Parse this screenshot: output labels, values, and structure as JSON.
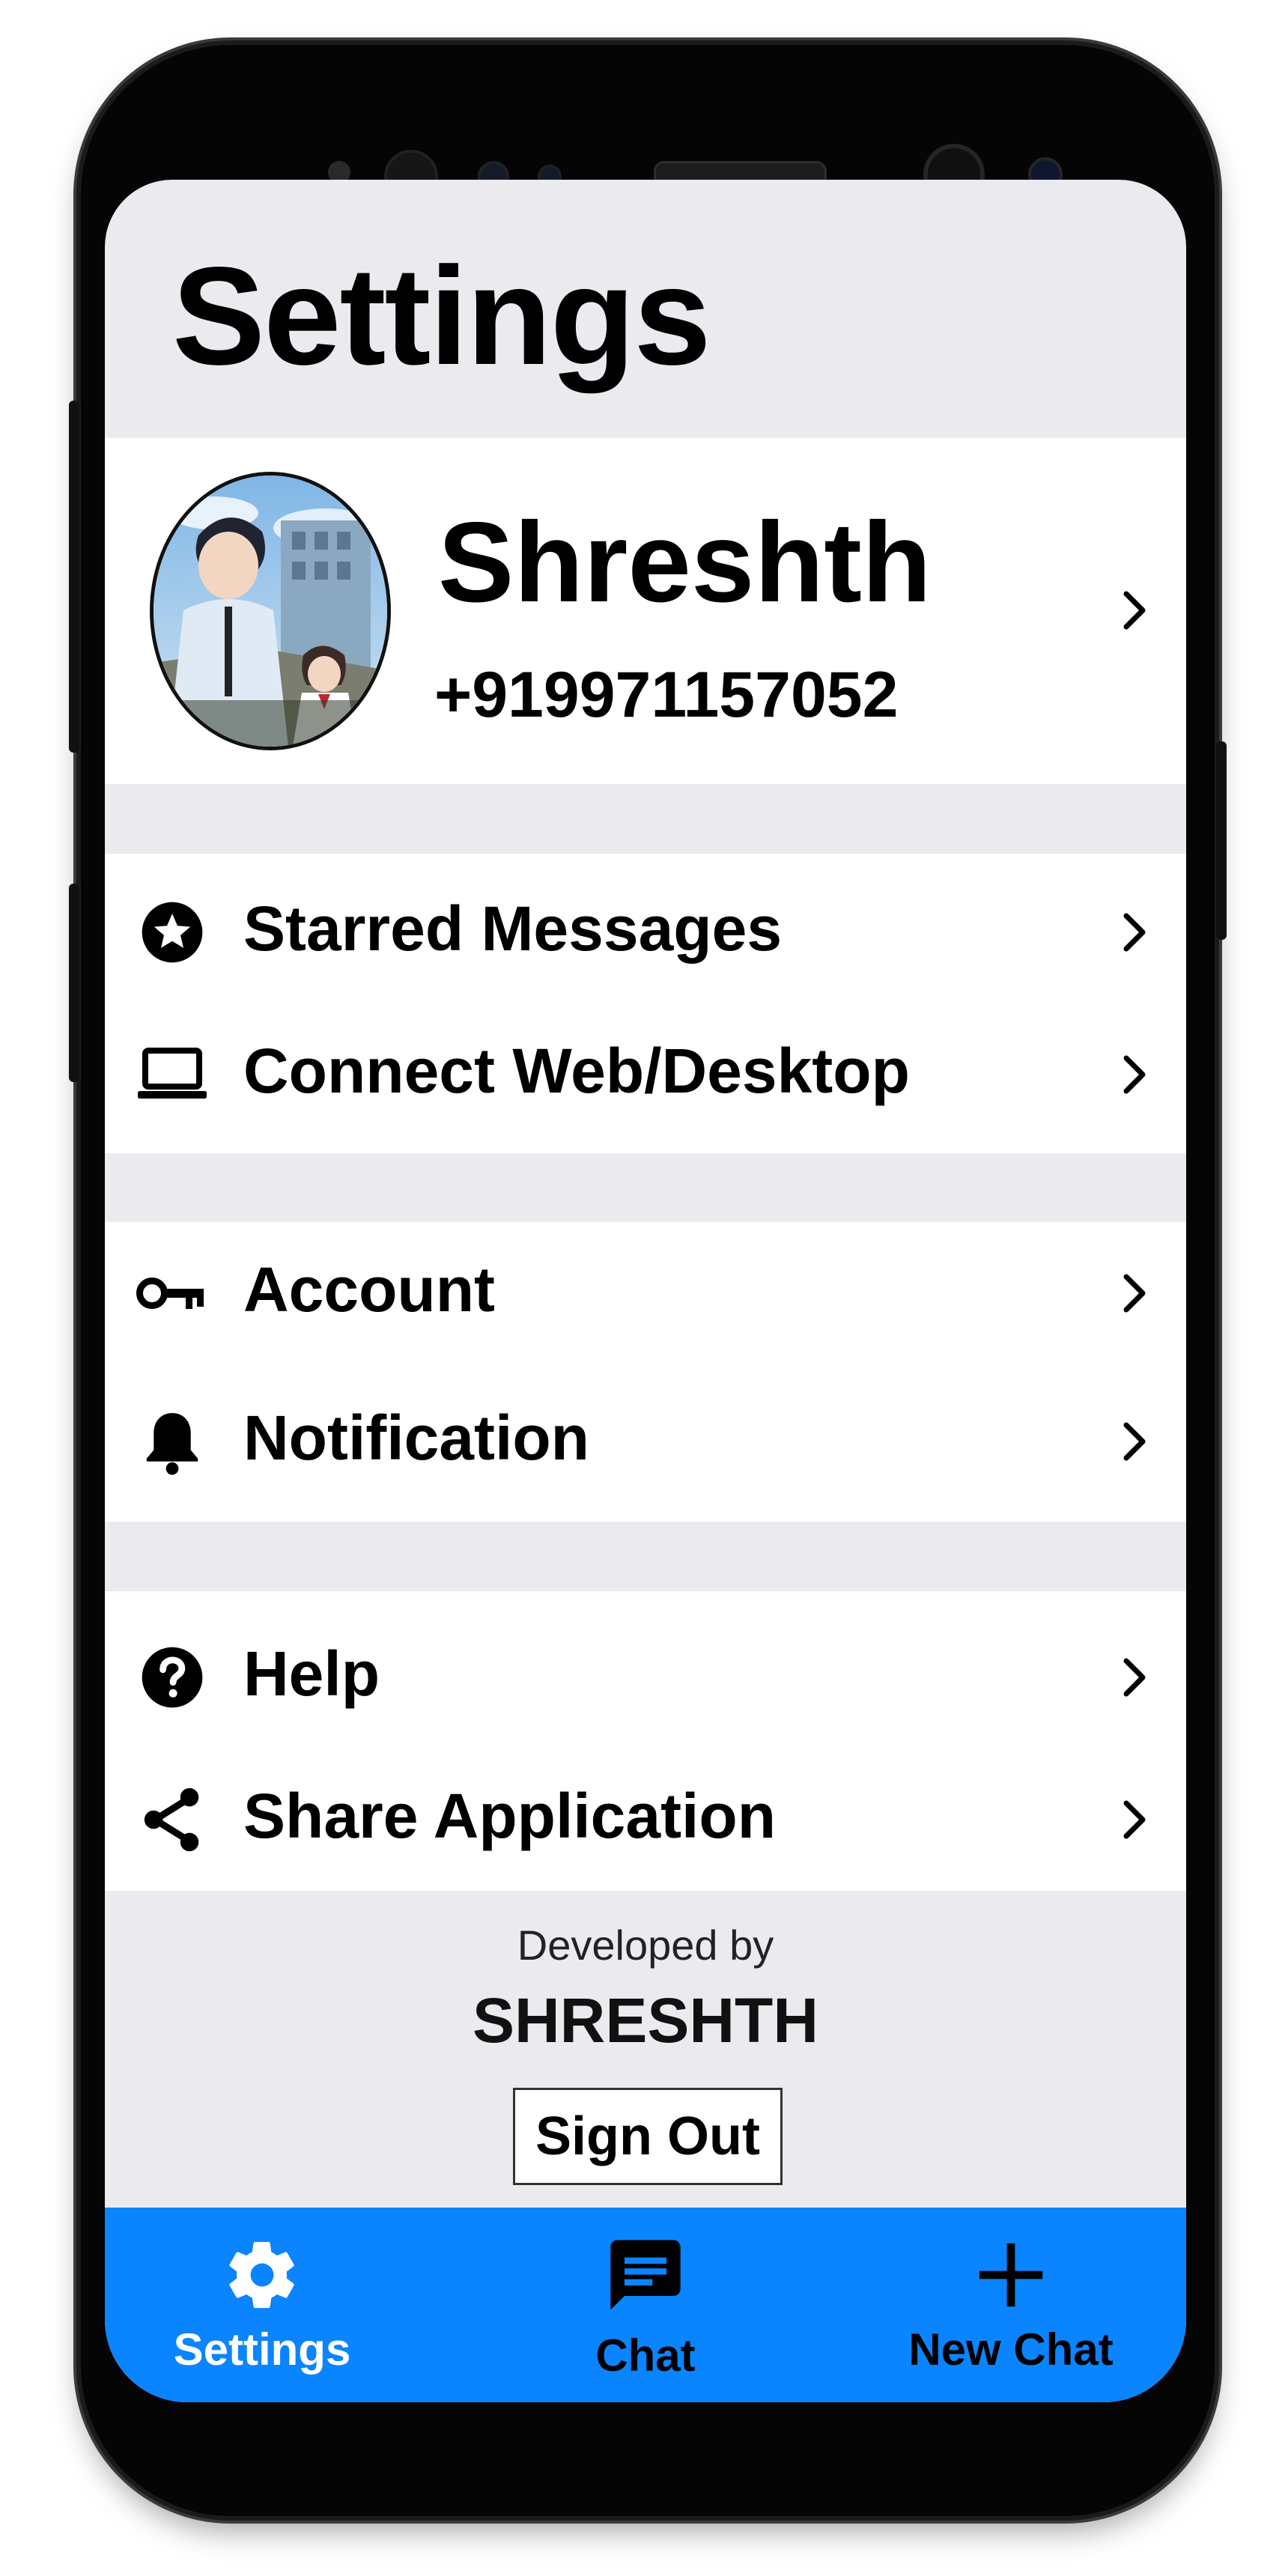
{
  "header": {
    "title": "Settings"
  },
  "profile": {
    "name": "Shreshth",
    "phone": "+919971157052"
  },
  "menu": {
    "starred": "Starred Messages",
    "connect": "Connect Web/Desktop",
    "account": "Account",
    "notification": "Notification",
    "help": "Help",
    "share": "Share Application"
  },
  "footer": {
    "developed_by": "Developed by",
    "developer": "SHRESHTH",
    "sign_out": "Sign Out"
  },
  "tabs": [
    {
      "label": "Settings",
      "icon": "gear-icon",
      "active": true
    },
    {
      "label": "Chat",
      "icon": "chat-icon",
      "active": false
    },
    {
      "label": "New Chat",
      "icon": "plus-icon",
      "active": false
    }
  ],
  "colors": {
    "tab_bar": "#0a84ff",
    "screen_background": "#ebebef",
    "active_tab": "#ffffff",
    "inactive_tab": "#000000"
  }
}
